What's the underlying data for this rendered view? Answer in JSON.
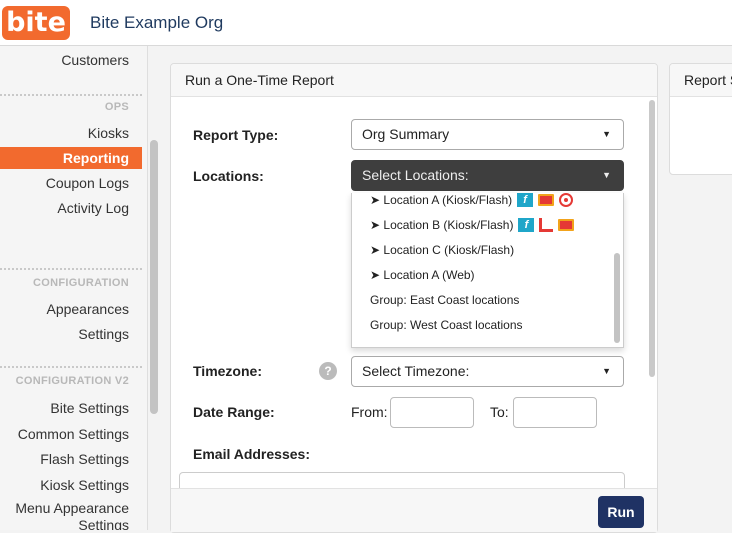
{
  "header": {
    "logo_text": "bite",
    "org_name": "Bite Example Org"
  },
  "sidebar": {
    "items_top": [
      {
        "label": "Customers"
      }
    ],
    "sections": [
      {
        "title": "OPS",
        "items": [
          "Kiosks",
          "Reporting",
          "Coupon Logs",
          "Activity Log"
        ]
      },
      {
        "title": "CONFIGURATION",
        "items": [
          "Appearances",
          "Settings"
        ]
      },
      {
        "title": "CONFIGURATION V2",
        "items": [
          "Bite Settings",
          "Common Settings",
          "Flash Settings",
          "Kiosk Settings",
          "Menu Appearance Settings"
        ]
      }
    ],
    "active_item": "Reporting",
    "colors": {
      "accent": "#f26a2e"
    }
  },
  "report_card": {
    "title": "Run a One-Time Report",
    "report_type_label": "Report Type:",
    "report_type_value": "Org Summary",
    "locations_label": "Locations:",
    "locations_placeholder": "Select Locations:",
    "location_options": [
      {
        "label": "➤ Location A (Kiosk/Flash)",
        "icons": [
          "flash-icon",
          "bag-icon",
          "delivery-icon"
        ]
      },
      {
        "label": "➤ Location B (Kiosk/Flash)",
        "icons": [
          "flash-icon",
          "chair-icon",
          "bag-icon"
        ]
      },
      {
        "label": "➤ Location C (Kiosk/Flash)",
        "icons": []
      },
      {
        "label": "➤ Location A (Web)",
        "icons": []
      },
      {
        "label": "Group: East Coast locations",
        "icons": []
      },
      {
        "label": "Group: West Coast locations",
        "icons": []
      }
    ],
    "timezone_label": "Timezone:",
    "timezone_help": "?",
    "timezone_placeholder": "Select Timezone:",
    "date_range_label": "Date Range:",
    "from_label": "From:",
    "to_label": "To:",
    "from_value": "",
    "to_value": "",
    "email_label": "Email Addresses:",
    "email_value": "",
    "run_label": "Run",
    "colors": {
      "run_button": "#1f3264",
      "dropdown_open": "#3e3e3e"
    }
  },
  "side_card": {
    "title": "Report S"
  }
}
